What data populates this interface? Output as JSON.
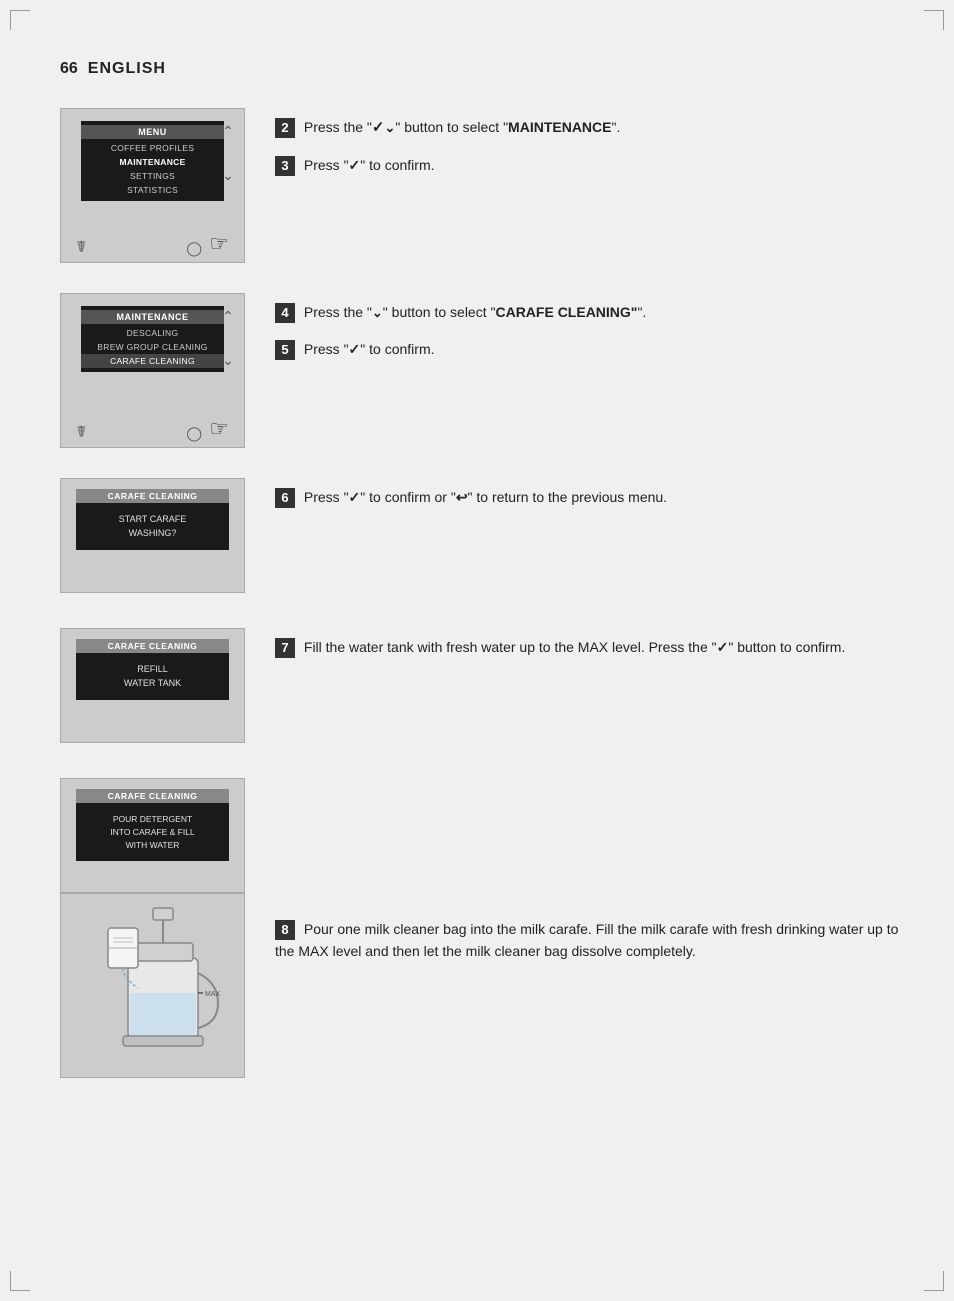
{
  "header": {
    "page_number": "66",
    "language": "ENGLISH"
  },
  "steps": [
    {
      "number": "2",
      "text_parts": [
        "Press the \"",
        "\" button to select \"",
        "MAINTENANCE",
        "\"."
      ],
      "symbol": "down-arrow"
    },
    {
      "number": "3",
      "text_parts": [
        "Press \"",
        "\" to confirm."
      ],
      "symbol": "check"
    },
    {
      "number": "4",
      "text_parts": [
        "Press the \"",
        "\" button to select \"",
        "CARAFE CLEANING",
        "\"."
      ],
      "symbol": "down-arrow"
    },
    {
      "number": "5",
      "text_parts": [
        "Press \"",
        "\" to confirm."
      ],
      "symbol": "check"
    },
    {
      "number": "6",
      "text_parts": [
        "Press \"",
        "\" to confirm or \"",
        "\" to return to the previous menu."
      ],
      "symbol1": "check",
      "symbol2": "back-arrow"
    },
    {
      "number": "7",
      "text_parts": [
        "Fill the water tank with fresh water up to the MAX level. Press the \"",
        "\" button to confirm."
      ],
      "symbol": "check"
    },
    {
      "number": "8",
      "text_parts": [
        "Pour one milk cleaner bag into the milk carafe. Fill the milk carafe with fresh drinking water up to the MAX level and then let the milk cleaner bag dissolve completely."
      ]
    }
  ],
  "screens": {
    "menu": {
      "title": "MENU",
      "items": [
        "COFFEE PROFILES",
        "MAINTENANCE",
        "SETTINGS",
        "STATISTICS"
      ]
    },
    "maintenance": {
      "title": "MAINTENANCE",
      "items": [
        "DESCALING",
        "BREW GROUP CLEANING",
        "CARAFE CLEANING"
      ]
    },
    "carafe_wash": {
      "title": "CARAFE CLEANING",
      "body": "START CARAFE\nWASHING?"
    },
    "carafe_refill": {
      "title": "CARAFE CLEANING",
      "body": "REFILL\nWATER TANK"
    },
    "carafe_detergent": {
      "title": "CARAFE CLEANING",
      "body": "POUR DETERGENT\nINTO CARAFE & FILL\nWITH WATER"
    }
  }
}
